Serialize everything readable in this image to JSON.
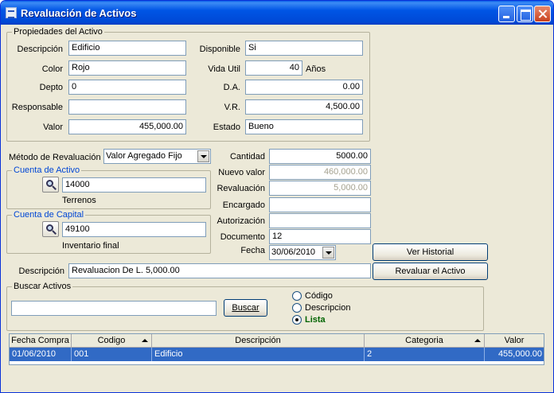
{
  "window": {
    "title": "Revaluación de Activos"
  },
  "propiedades": {
    "legend": "Propiedades del Activo",
    "descripcion_label": "Descripción",
    "descripcion_value": "Edificio",
    "color_label": "Color",
    "color_value": "Rojo",
    "depto_label": "Depto",
    "depto_value": "0",
    "responsable_label": "Responsable",
    "responsable_value": "",
    "valor_label": "Valor",
    "valor_value": "455,000.00",
    "disponible_label": "Disponible",
    "disponible_value": "Si",
    "vida_util_label": "Vida Util",
    "vida_util_value": "40",
    "vida_util_unit": "Años",
    "da_label": "D.A.",
    "da_value": "0.00",
    "vr_label": "V.R.",
    "vr_value": "4,500.00",
    "estado_label": "Estado",
    "estado_value": "Bueno"
  },
  "metodo": {
    "label": "Método de Revaluación",
    "value": "Valor Agregado Fijo"
  },
  "cuenta_activo": {
    "legend": "Cuenta de Activo",
    "code": "14000",
    "name": "Terrenos"
  },
  "cuenta_capital": {
    "legend": "Cuenta de Capital",
    "code": "49100",
    "name": "Inventario final"
  },
  "calc": {
    "cantidad_label": "Cantidad",
    "cantidad_value": "5000.00",
    "nuevo_valor_label": "Nuevo valor",
    "nuevo_valor_value": "460,000.00",
    "revaluacion_label": "Revaluación",
    "revaluacion_value": "5,000.00",
    "encargado_label": "Encargado",
    "encargado_value": "",
    "autorizacion_label": "Autorización",
    "autorizacion_value": "",
    "documento_label": "Documento",
    "documento_value": "12",
    "fecha_label": "Fecha",
    "fecha_value": "30/06/2010"
  },
  "buttons": {
    "ver_historial": "Ver Historial",
    "revaluar": "Revaluar el Activo"
  },
  "descripcion": {
    "label": "Descripción",
    "value": "Revaluacion De L. 5,000.00"
  },
  "buscar": {
    "legend": "Buscar Activos",
    "input_value": "",
    "button_label": "Buscar",
    "options": [
      {
        "label": "Código",
        "selected": false
      },
      {
        "label": "Descripcion",
        "selected": false
      },
      {
        "label": "Lista",
        "selected": true
      }
    ]
  },
  "table": {
    "headers": [
      "Fecha Compra",
      "Codigo",
      "Descripción",
      "Categoria",
      "Valor"
    ],
    "rows": [
      {
        "fecha": "01/06/2010",
        "codigo": "001",
        "descripcion": "Edificio",
        "categoria": "2",
        "valor": "455,000.00"
      }
    ]
  },
  "colors": {
    "title_bar": "#0055e5",
    "selection": "#316ac5",
    "group_legend_blue": "#0046d5",
    "lista_green": "#006400"
  }
}
